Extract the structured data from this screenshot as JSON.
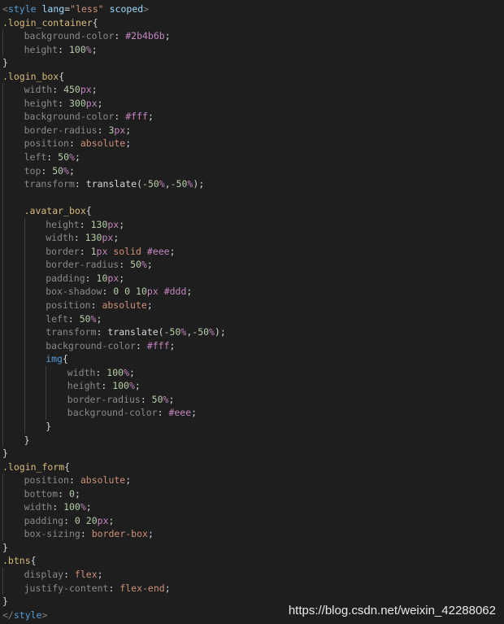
{
  "colors": {
    "background": "#1e1e1e",
    "tag": "#808080",
    "tag_name": "#569cd6",
    "attribute": "#9cdcfe",
    "string": "#ce9178",
    "selector": "#d7ba7d",
    "property": "#8a8a8a",
    "number": "#b5cea8",
    "keyword": "#ce9178",
    "hex": "#c586c0"
  },
  "code": {
    "lines": [
      {
        "indent": 0,
        "tokens": [
          [
            "tag",
            "<"
          ],
          [
            "tagname",
            "style"
          ],
          [
            "plain",
            " "
          ],
          [
            "attr",
            "lang"
          ],
          [
            "plain",
            "="
          ],
          [
            "str",
            "\"less\""
          ],
          [
            "plain",
            " "
          ],
          [
            "attr",
            "scoped"
          ],
          [
            "tag",
            ">"
          ]
        ]
      },
      {
        "indent": 0,
        "tokens": [
          [
            "sel",
            ".login_container"
          ],
          [
            "brace",
            "{"
          ]
        ]
      },
      {
        "indent": 1,
        "tokens": [
          [
            "prop",
            "background-color"
          ],
          [
            "punc",
            ": "
          ],
          [
            "hex",
            "#2b4b6b"
          ],
          [
            "punc",
            ";"
          ]
        ]
      },
      {
        "indent": 1,
        "tokens": [
          [
            "prop",
            "height"
          ],
          [
            "punc",
            ": "
          ],
          [
            "num",
            "100"
          ],
          [
            "unit",
            "%"
          ],
          [
            "punc",
            ";"
          ]
        ]
      },
      {
        "indent": 0,
        "tokens": [
          [
            "brace",
            "}"
          ]
        ]
      },
      {
        "indent": 0,
        "tokens": [
          [
            "sel",
            ".login_box"
          ],
          [
            "brace",
            "{"
          ]
        ]
      },
      {
        "indent": 1,
        "tokens": [
          [
            "prop",
            "width"
          ],
          [
            "punc",
            ": "
          ],
          [
            "num",
            "450"
          ],
          [
            "unit",
            "px"
          ],
          [
            "punc",
            ";"
          ]
        ]
      },
      {
        "indent": 1,
        "tokens": [
          [
            "prop",
            "height"
          ],
          [
            "punc",
            ": "
          ],
          [
            "num",
            "300"
          ],
          [
            "unit",
            "px"
          ],
          [
            "punc",
            ";"
          ]
        ]
      },
      {
        "indent": 1,
        "tokens": [
          [
            "prop",
            "background-color"
          ],
          [
            "punc",
            ": "
          ],
          [
            "hex",
            "#fff"
          ],
          [
            "punc",
            ";"
          ]
        ]
      },
      {
        "indent": 1,
        "tokens": [
          [
            "prop",
            "border-radius"
          ],
          [
            "punc",
            ": "
          ],
          [
            "num",
            "3"
          ],
          [
            "unit",
            "px"
          ],
          [
            "punc",
            ";"
          ]
        ]
      },
      {
        "indent": 1,
        "tokens": [
          [
            "prop",
            "position"
          ],
          [
            "punc",
            ": "
          ],
          [
            "kw",
            "absolute"
          ],
          [
            "punc",
            ";"
          ]
        ]
      },
      {
        "indent": 1,
        "tokens": [
          [
            "prop",
            "left"
          ],
          [
            "punc",
            ": "
          ],
          [
            "num",
            "50"
          ],
          [
            "unit",
            "%"
          ],
          [
            "punc",
            ";"
          ]
        ]
      },
      {
        "indent": 1,
        "tokens": [
          [
            "prop",
            "top"
          ],
          [
            "punc",
            ": "
          ],
          [
            "num",
            "50"
          ],
          [
            "unit",
            "%"
          ],
          [
            "punc",
            ";"
          ]
        ]
      },
      {
        "indent": 1,
        "tokens": [
          [
            "prop",
            "transform"
          ],
          [
            "punc",
            ": "
          ],
          [
            "plain",
            "translate"
          ],
          [
            "punc",
            "("
          ],
          [
            "num",
            "-50"
          ],
          [
            "unit",
            "%"
          ],
          [
            "punc",
            ","
          ],
          [
            "num",
            "-50"
          ],
          [
            "unit",
            "%"
          ],
          [
            "punc",
            ");"
          ]
        ]
      },
      {
        "indent": 1,
        "tokens": []
      },
      {
        "indent": 1,
        "tokens": [
          [
            "sel",
            ".avatar_box"
          ],
          [
            "brace",
            "{"
          ]
        ]
      },
      {
        "indent": 2,
        "tokens": [
          [
            "prop",
            "height"
          ],
          [
            "punc",
            ": "
          ],
          [
            "num",
            "130"
          ],
          [
            "unit",
            "px"
          ],
          [
            "punc",
            ";"
          ]
        ]
      },
      {
        "indent": 2,
        "tokens": [
          [
            "prop",
            "width"
          ],
          [
            "punc",
            ": "
          ],
          [
            "num",
            "130"
          ],
          [
            "unit",
            "px"
          ],
          [
            "punc",
            ";"
          ]
        ]
      },
      {
        "indent": 2,
        "tokens": [
          [
            "prop",
            "border"
          ],
          [
            "punc",
            ": "
          ],
          [
            "num",
            "1"
          ],
          [
            "unit",
            "px"
          ],
          [
            "plain",
            " "
          ],
          [
            "kw",
            "solid"
          ],
          [
            "plain",
            " "
          ],
          [
            "hex",
            "#eee"
          ],
          [
            "punc",
            ";"
          ]
        ]
      },
      {
        "indent": 2,
        "tokens": [
          [
            "prop",
            "border-radius"
          ],
          [
            "punc",
            ": "
          ],
          [
            "num",
            "50"
          ],
          [
            "unit",
            "%"
          ],
          [
            "punc",
            ";"
          ]
        ]
      },
      {
        "indent": 2,
        "tokens": [
          [
            "prop",
            "padding"
          ],
          [
            "punc",
            ": "
          ],
          [
            "num",
            "10"
          ],
          [
            "unit",
            "px"
          ],
          [
            "punc",
            ";"
          ]
        ]
      },
      {
        "indent": 2,
        "tokens": [
          [
            "prop",
            "box-shadow"
          ],
          [
            "punc",
            ": "
          ],
          [
            "num",
            "0"
          ],
          [
            "plain",
            " "
          ],
          [
            "num",
            "0"
          ],
          [
            "plain",
            " "
          ],
          [
            "num",
            "10"
          ],
          [
            "unit",
            "px"
          ],
          [
            "plain",
            " "
          ],
          [
            "hex",
            "#ddd"
          ],
          [
            "punc",
            ";"
          ]
        ]
      },
      {
        "indent": 2,
        "tokens": [
          [
            "prop",
            "position"
          ],
          [
            "punc",
            ": "
          ],
          [
            "kw",
            "absolute"
          ],
          [
            "punc",
            ";"
          ]
        ]
      },
      {
        "indent": 2,
        "tokens": [
          [
            "prop",
            "left"
          ],
          [
            "punc",
            ": "
          ],
          [
            "num",
            "50"
          ],
          [
            "unit",
            "%"
          ],
          [
            "punc",
            ";"
          ]
        ]
      },
      {
        "indent": 2,
        "tokens": [
          [
            "prop",
            "transform"
          ],
          [
            "punc",
            ": "
          ],
          [
            "plain",
            "translate"
          ],
          [
            "punc",
            "("
          ],
          [
            "num",
            "-50"
          ],
          [
            "unit",
            "%"
          ],
          [
            "punc",
            ","
          ],
          [
            "num",
            "-50"
          ],
          [
            "unit",
            "%"
          ],
          [
            "punc",
            ");"
          ]
        ]
      },
      {
        "indent": 2,
        "tokens": [
          [
            "prop",
            "background-color"
          ],
          [
            "punc",
            ": "
          ],
          [
            "hex",
            "#fff"
          ],
          [
            "punc",
            ";"
          ]
        ]
      },
      {
        "indent": 2,
        "tokens": [
          [
            "tagname",
            "img"
          ],
          [
            "brace",
            "{"
          ]
        ]
      },
      {
        "indent": 3,
        "tokens": [
          [
            "prop",
            "width"
          ],
          [
            "punc",
            ": "
          ],
          [
            "num",
            "100"
          ],
          [
            "unit",
            "%"
          ],
          [
            "punc",
            ";"
          ]
        ]
      },
      {
        "indent": 3,
        "tokens": [
          [
            "prop",
            "height"
          ],
          [
            "punc",
            ": "
          ],
          [
            "num",
            "100"
          ],
          [
            "unit",
            "%"
          ],
          [
            "punc",
            ";"
          ]
        ]
      },
      {
        "indent": 3,
        "tokens": [
          [
            "prop",
            "border-radius"
          ],
          [
            "punc",
            ": "
          ],
          [
            "num",
            "50"
          ],
          [
            "unit",
            "%"
          ],
          [
            "punc",
            ";"
          ]
        ]
      },
      {
        "indent": 3,
        "tokens": [
          [
            "prop",
            "background-color"
          ],
          [
            "punc",
            ": "
          ],
          [
            "hex",
            "#eee"
          ],
          [
            "punc",
            ";"
          ]
        ]
      },
      {
        "indent": 2,
        "tokens": [
          [
            "brace",
            "}"
          ]
        ]
      },
      {
        "indent": 1,
        "tokens": [
          [
            "brace",
            "}"
          ]
        ]
      },
      {
        "indent": 0,
        "tokens": [
          [
            "brace",
            "}"
          ]
        ]
      },
      {
        "indent": 0,
        "tokens": [
          [
            "sel",
            ".login_form"
          ],
          [
            "brace",
            "{"
          ]
        ]
      },
      {
        "indent": 1,
        "tokens": [
          [
            "prop",
            "position"
          ],
          [
            "punc",
            ": "
          ],
          [
            "kw",
            "absolute"
          ],
          [
            "punc",
            ";"
          ]
        ]
      },
      {
        "indent": 1,
        "tokens": [
          [
            "prop",
            "bottom"
          ],
          [
            "punc",
            ": "
          ],
          [
            "num",
            "0"
          ],
          [
            "punc",
            ";"
          ]
        ]
      },
      {
        "indent": 1,
        "tokens": [
          [
            "prop",
            "width"
          ],
          [
            "punc",
            ": "
          ],
          [
            "num",
            "100"
          ],
          [
            "unit",
            "%"
          ],
          [
            "punc",
            ";"
          ]
        ]
      },
      {
        "indent": 1,
        "tokens": [
          [
            "prop",
            "padding"
          ],
          [
            "punc",
            ": "
          ],
          [
            "num",
            "0"
          ],
          [
            "plain",
            " "
          ],
          [
            "num",
            "20"
          ],
          [
            "unit",
            "px"
          ],
          [
            "punc",
            ";"
          ]
        ]
      },
      {
        "indent": 1,
        "tokens": [
          [
            "prop",
            "box-sizing"
          ],
          [
            "punc",
            ": "
          ],
          [
            "kw",
            "border-box"
          ],
          [
            "punc",
            ";"
          ]
        ]
      },
      {
        "indent": 0,
        "tokens": [
          [
            "brace",
            "}"
          ]
        ]
      },
      {
        "indent": 0,
        "tokens": [
          [
            "sel",
            ".btns"
          ],
          [
            "brace",
            "{"
          ]
        ]
      },
      {
        "indent": 1,
        "tokens": [
          [
            "prop",
            "display"
          ],
          [
            "punc",
            ": "
          ],
          [
            "kw",
            "flex"
          ],
          [
            "punc",
            ";"
          ]
        ]
      },
      {
        "indent": 1,
        "tokens": [
          [
            "prop",
            "justify-content"
          ],
          [
            "punc",
            ": "
          ],
          [
            "kw",
            "flex-end"
          ],
          [
            "punc",
            ";"
          ]
        ]
      },
      {
        "indent": 0,
        "tokens": [
          [
            "brace",
            "}"
          ]
        ]
      },
      {
        "indent": 0,
        "tokens": [
          [
            "tag",
            "</"
          ],
          [
            "tagname",
            "style"
          ],
          [
            "tag",
            ">"
          ]
        ]
      }
    ]
  },
  "watermark": "https://blog.csdn.net/weixin_42288062"
}
